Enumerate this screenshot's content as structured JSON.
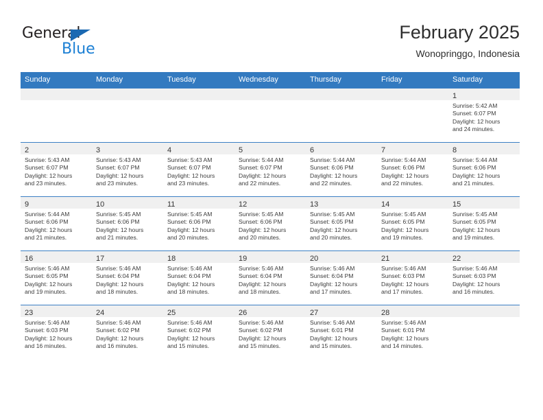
{
  "brand": {
    "name_part1": "General",
    "name_part2": "Blue",
    "triangle_color": "#1b69b2",
    "blue_color": "#1b7fd4"
  },
  "header": {
    "title": "February 2025",
    "subtitle": "Wonopringgo, Indonesia"
  },
  "theme": {
    "header_bg": "#337ac0",
    "row_divider": "#3b7fc4",
    "daynum_band": "#f0f0f0"
  },
  "weekdays": [
    "Sunday",
    "Monday",
    "Tuesday",
    "Wednesday",
    "Thursday",
    "Friday",
    "Saturday"
  ],
  "weeks": [
    [
      {
        "day": "",
        "lines": []
      },
      {
        "day": "",
        "lines": []
      },
      {
        "day": "",
        "lines": []
      },
      {
        "day": "",
        "lines": []
      },
      {
        "day": "",
        "lines": []
      },
      {
        "day": "",
        "lines": []
      },
      {
        "day": "1",
        "lines": [
          "Sunrise: 5:42 AM",
          "Sunset: 6:07 PM",
          "Daylight: 12 hours",
          "and 24 minutes."
        ]
      }
    ],
    [
      {
        "day": "2",
        "lines": [
          "Sunrise: 5:43 AM",
          "Sunset: 6:07 PM",
          "Daylight: 12 hours",
          "and 23 minutes."
        ]
      },
      {
        "day": "3",
        "lines": [
          "Sunrise: 5:43 AM",
          "Sunset: 6:07 PM",
          "Daylight: 12 hours",
          "and 23 minutes."
        ]
      },
      {
        "day": "4",
        "lines": [
          "Sunrise: 5:43 AM",
          "Sunset: 6:07 PM",
          "Daylight: 12 hours",
          "and 23 minutes."
        ]
      },
      {
        "day": "5",
        "lines": [
          "Sunrise: 5:44 AM",
          "Sunset: 6:07 PM",
          "Daylight: 12 hours",
          "and 22 minutes."
        ]
      },
      {
        "day": "6",
        "lines": [
          "Sunrise: 5:44 AM",
          "Sunset: 6:06 PM",
          "Daylight: 12 hours",
          "and 22 minutes."
        ]
      },
      {
        "day": "7",
        "lines": [
          "Sunrise: 5:44 AM",
          "Sunset: 6:06 PM",
          "Daylight: 12 hours",
          "and 22 minutes."
        ]
      },
      {
        "day": "8",
        "lines": [
          "Sunrise: 5:44 AM",
          "Sunset: 6:06 PM",
          "Daylight: 12 hours",
          "and 21 minutes."
        ]
      }
    ],
    [
      {
        "day": "9",
        "lines": [
          "Sunrise: 5:44 AM",
          "Sunset: 6:06 PM",
          "Daylight: 12 hours",
          "and 21 minutes."
        ]
      },
      {
        "day": "10",
        "lines": [
          "Sunrise: 5:45 AM",
          "Sunset: 6:06 PM",
          "Daylight: 12 hours",
          "and 21 minutes."
        ]
      },
      {
        "day": "11",
        "lines": [
          "Sunrise: 5:45 AM",
          "Sunset: 6:06 PM",
          "Daylight: 12 hours",
          "and 20 minutes."
        ]
      },
      {
        "day": "12",
        "lines": [
          "Sunrise: 5:45 AM",
          "Sunset: 6:06 PM",
          "Daylight: 12 hours",
          "and 20 minutes."
        ]
      },
      {
        "day": "13",
        "lines": [
          "Sunrise: 5:45 AM",
          "Sunset: 6:05 PM",
          "Daylight: 12 hours",
          "and 20 minutes."
        ]
      },
      {
        "day": "14",
        "lines": [
          "Sunrise: 5:45 AM",
          "Sunset: 6:05 PM",
          "Daylight: 12 hours",
          "and 19 minutes."
        ]
      },
      {
        "day": "15",
        "lines": [
          "Sunrise: 5:45 AM",
          "Sunset: 6:05 PM",
          "Daylight: 12 hours",
          "and 19 minutes."
        ]
      }
    ],
    [
      {
        "day": "16",
        "lines": [
          "Sunrise: 5:46 AM",
          "Sunset: 6:05 PM",
          "Daylight: 12 hours",
          "and 19 minutes."
        ]
      },
      {
        "day": "17",
        "lines": [
          "Sunrise: 5:46 AM",
          "Sunset: 6:04 PM",
          "Daylight: 12 hours",
          "and 18 minutes."
        ]
      },
      {
        "day": "18",
        "lines": [
          "Sunrise: 5:46 AM",
          "Sunset: 6:04 PM",
          "Daylight: 12 hours",
          "and 18 minutes."
        ]
      },
      {
        "day": "19",
        "lines": [
          "Sunrise: 5:46 AM",
          "Sunset: 6:04 PM",
          "Daylight: 12 hours",
          "and 18 minutes."
        ]
      },
      {
        "day": "20",
        "lines": [
          "Sunrise: 5:46 AM",
          "Sunset: 6:04 PM",
          "Daylight: 12 hours",
          "and 17 minutes."
        ]
      },
      {
        "day": "21",
        "lines": [
          "Sunrise: 5:46 AM",
          "Sunset: 6:03 PM",
          "Daylight: 12 hours",
          "and 17 minutes."
        ]
      },
      {
        "day": "22",
        "lines": [
          "Sunrise: 5:46 AM",
          "Sunset: 6:03 PM",
          "Daylight: 12 hours",
          "and 16 minutes."
        ]
      }
    ],
    [
      {
        "day": "23",
        "lines": [
          "Sunrise: 5:46 AM",
          "Sunset: 6:03 PM",
          "Daylight: 12 hours",
          "and 16 minutes."
        ]
      },
      {
        "day": "24",
        "lines": [
          "Sunrise: 5:46 AM",
          "Sunset: 6:02 PM",
          "Daylight: 12 hours",
          "and 16 minutes."
        ]
      },
      {
        "day": "25",
        "lines": [
          "Sunrise: 5:46 AM",
          "Sunset: 6:02 PM",
          "Daylight: 12 hours",
          "and 15 minutes."
        ]
      },
      {
        "day": "26",
        "lines": [
          "Sunrise: 5:46 AM",
          "Sunset: 6:02 PM",
          "Daylight: 12 hours",
          "and 15 minutes."
        ]
      },
      {
        "day": "27",
        "lines": [
          "Sunrise: 5:46 AM",
          "Sunset: 6:01 PM",
          "Daylight: 12 hours",
          "and 15 minutes."
        ]
      },
      {
        "day": "28",
        "lines": [
          "Sunrise: 5:46 AM",
          "Sunset: 6:01 PM",
          "Daylight: 12 hours",
          "and 14 minutes."
        ]
      },
      {
        "day": "",
        "lines": []
      }
    ]
  ]
}
